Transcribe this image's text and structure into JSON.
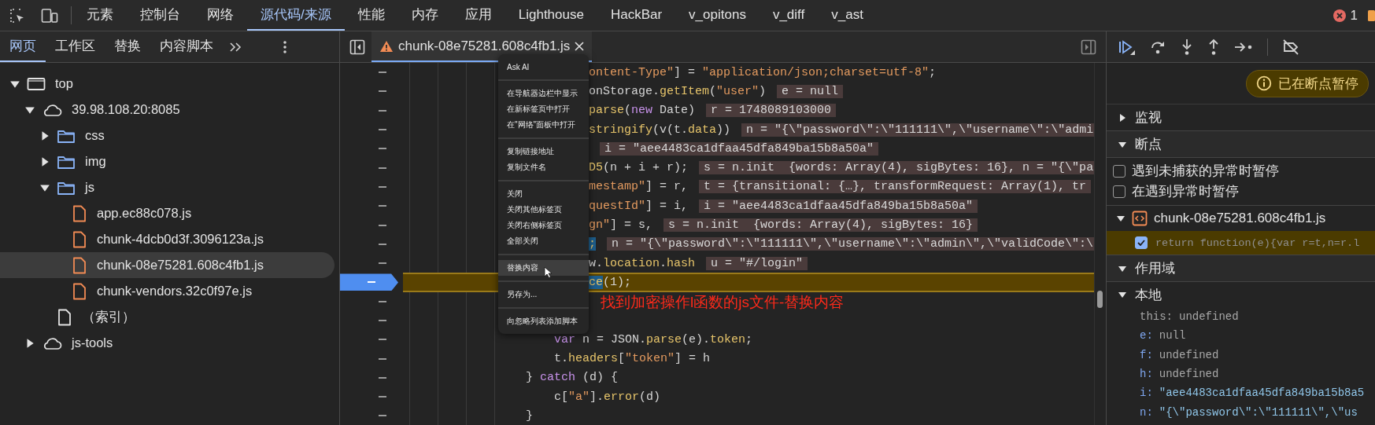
{
  "toolbar": {
    "tabs": [
      {
        "label": "元素",
        "selected": false
      },
      {
        "label": "控制台",
        "selected": false
      },
      {
        "label": "网络",
        "selected": false
      },
      {
        "label": "源代码/来源",
        "selected": true
      },
      {
        "label": "性能",
        "selected": false
      },
      {
        "label": "内存",
        "selected": false
      },
      {
        "label": "应用",
        "selected": false
      },
      {
        "label": "Lighthouse",
        "selected": false
      },
      {
        "label": "HackBar",
        "selected": false
      },
      {
        "label": "v_opitons",
        "selected": false
      },
      {
        "label": "v_diff",
        "selected": false
      },
      {
        "label": "v_ast",
        "selected": false
      }
    ],
    "error_count": "1"
  },
  "navigator": {
    "tabs": [
      {
        "label": "网页",
        "selected": true
      },
      {
        "label": "工作区",
        "selected": false
      },
      {
        "label": "替换",
        "selected": false
      },
      {
        "label": "内容脚本",
        "selected": false
      }
    ],
    "tree": [
      {
        "label": "top",
        "kind": "frame",
        "expanded": true,
        "selected": false,
        "children": [
          {
            "label": "39.98.108.20:8085",
            "kind": "domain",
            "expanded": true,
            "selected": false,
            "children": [
              {
                "label": "css",
                "kind": "folder",
                "expanded": false,
                "selected": false
              },
              {
                "label": "img",
                "kind": "folder",
                "expanded": false,
                "selected": false
              },
              {
                "label": "js",
                "kind": "folder",
                "expanded": true,
                "selected": false,
                "children": [
                  {
                    "label": "app.ec88c078.js",
                    "kind": "script",
                    "selected": false
                  },
                  {
                    "label": "chunk-4dcb0d3f.3096123a.js",
                    "kind": "script",
                    "selected": false
                  },
                  {
                    "label": "chunk-08e75281.608c4fb1.js",
                    "kind": "script",
                    "selected": true
                  },
                  {
                    "label": "chunk-vendors.32c0f97e.js",
                    "kind": "script",
                    "selected": false
                  }
                ]
              },
              {
                "label": "（索引）",
                "kind": "document",
                "selected": false
              }
            ]
          },
          {
            "label": "js-tools",
            "kind": "domain",
            "expanded": false,
            "selected": false
          }
        ]
      }
    ]
  },
  "editor": {
    "tab": {
      "title": "chunk-08e75281.608c4fb1.js",
      "warning": true
    },
    "lines": [
      {
        "kind": "clipped",
        "paused": false,
        "tokens": [
          {
            "kind": "string",
            "text": "ontent-Type\""
          },
          {
            "kind": "plain",
            "text": "] = "
          },
          {
            "kind": "string",
            "text": "\"application/json;charset=utf-8\""
          },
          {
            "kind": "plain",
            "text": ";"
          }
        ]
      },
      {
        "kind": "clipped",
        "paused": false,
        "tokens": [
          {
            "kind": "plain",
            "text": "onStorage."
          },
          {
            "kind": "function",
            "text": "getItem"
          },
          {
            "kind": "plain",
            "text": "("
          },
          {
            "kind": "string",
            "text": "\"user\""
          },
          {
            "kind": "plain",
            "text": ")"
          }
        ],
        "value": "e = null"
      },
      {
        "kind": "clipped",
        "paused": false,
        "tokens": [
          {
            "kind": "function",
            "text": "parse"
          },
          {
            "kind": "plain",
            "text": "("
          },
          {
            "kind": "keyword",
            "text": "new"
          },
          {
            "kind": "plain",
            "text": " Date)"
          }
        ],
        "value": "r = 1748089103000"
      },
      {
        "kind": "clipped",
        "paused": false,
        "tokens": [
          {
            "kind": "function",
            "text": "stringify"
          },
          {
            "kind": "plain",
            "text": "(v(t."
          },
          {
            "kind": "function",
            "text": "data"
          },
          {
            "kind": "plain",
            "text": "))"
          }
        ],
        "value": "n = \"{\\\"password\\\":\\\"111111\\\",\\\"username\\\":\\\"admi"
      },
      {
        "kind": "clipped",
        "paused": false,
        "value": "i = \"aee4483ca1dfaa45dfa849ba15b8a50a\""
      },
      {
        "kind": "clipped",
        "paused": false,
        "tokens": [
          {
            "kind": "function",
            "text": "D5"
          },
          {
            "kind": "plain",
            "text": "(n + i + r);"
          }
        ],
        "value": "s = n.init  {words: Array(4), sigBytes: 16}, n = \"{\\\"pa"
      },
      {
        "kind": "clipped",
        "paused": false,
        "tokens": [
          {
            "kind": "string",
            "text": "mestamp\""
          },
          {
            "kind": "plain",
            "text": "] = r,"
          }
        ],
        "value": "t = {transitional: {…}, transformRequest: Array(1), tr"
      },
      {
        "kind": "clipped",
        "paused": false,
        "tokens": [
          {
            "kind": "string",
            "text": "questId\""
          },
          {
            "kind": "plain",
            "text": "] = i,"
          }
        ],
        "value": "i = \"aee4483ca1dfaa45dfa849ba15b8a50a\""
      },
      {
        "kind": "clipped",
        "paused": false,
        "tokens": [
          {
            "kind": "string",
            "text": "gn\""
          },
          {
            "kind": "plain",
            "text": "] = s,"
          }
        ],
        "value": "s = n.init  {words: Array(4), sigBytes: 16}"
      },
      {
        "kind": "clipped",
        "paused": false,
        "tokens": [
          {
            "kind": "selection",
            "text": ";"
          }
        ],
        "value": "n = \"{\\\"password\\\":\\\"111111\\\",\\\"username\\\":\\\"admin\\\",\\\"validCode\\\":\\"
      },
      {
        "kind": "clipped",
        "paused": false,
        "tokens": [
          {
            "kind": "plain",
            "text": "w."
          },
          {
            "kind": "function",
            "text": "location"
          },
          {
            "kind": "plain",
            "text": "."
          },
          {
            "kind": "function",
            "text": "hash"
          }
        ],
        "value": "u = \"#/login\""
      },
      {
        "kind": "clipped",
        "paused": true,
        "tokens": [
          {
            "kind": "selection",
            "text": "ce"
          },
          {
            "kind": "plain",
            "text": "(1);"
          }
        ]
      },
      {
        "kind": "blank",
        "paused": false
      },
      {
        "kind": "blank",
        "paused": false
      },
      {
        "kind": "block",
        "paused": false,
        "tokens": [
          {
            "kind": "keyword",
            "text": "var"
          },
          {
            "kind": "plain",
            "text": " n = JSON."
          },
          {
            "kind": "function",
            "text": "parse"
          },
          {
            "kind": "plain",
            "text": "(e)."
          },
          {
            "kind": "function",
            "text": "token"
          },
          {
            "kind": "plain",
            "text": ";"
          }
        ]
      },
      {
        "kind": "block",
        "paused": false,
        "tokens": [
          {
            "kind": "plain",
            "text": "t."
          },
          {
            "kind": "function",
            "text": "headers"
          },
          {
            "kind": "plain",
            "text": "["
          },
          {
            "kind": "string",
            "text": "\"token\""
          },
          {
            "kind": "plain",
            "text": "] = h"
          }
        ]
      },
      {
        "kind": "brace",
        "paused": false,
        "tokens": [
          {
            "kind": "plain",
            "text": "} "
          },
          {
            "kind": "keyword",
            "text": "catch"
          },
          {
            "kind": "plain",
            "text": " (d) {"
          }
        ]
      },
      {
        "kind": "block",
        "paused": false,
        "tokens": [
          {
            "kind": "plain",
            "text": "c["
          },
          {
            "kind": "string",
            "text": "\"a\""
          },
          {
            "kind": "plain",
            "text": "]."
          },
          {
            "kind": "function",
            "text": "error"
          },
          {
            "kind": "plain",
            "text": "(d)"
          }
        ]
      },
      {
        "kind": "brace",
        "paused": false,
        "tokens": [
          {
            "kind": "plain",
            "text": "}"
          }
        ]
      }
    ],
    "note": "找到加密操作l函数的js文件-替换内容"
  },
  "context_menu": {
    "groups": [
      [
        {
          "label": "Ask AI",
          "selected": false
        }
      ],
      [
        {
          "label": "在导航器边栏中显示",
          "selected": false
        },
        {
          "label": "在新标签页中打开",
          "selected": false
        },
        {
          "label": "在\"网络\"面板中打开",
          "selected": false
        }
      ],
      [
        {
          "label": "复制链接地址",
          "selected": false
        },
        {
          "label": "复制文件名",
          "selected": false
        }
      ],
      [
        {
          "label": "关闭",
          "selected": false
        },
        {
          "label": "关闭其他标签页",
          "selected": false
        },
        {
          "label": "关闭右侧标签页",
          "selected": false
        },
        {
          "label": "全部关闭",
          "selected": false
        }
      ],
      [
        {
          "label": "替换内容",
          "selected": true
        }
      ],
      [
        {
          "label": "另存为...",
          "selected": false
        }
      ],
      [
        {
          "label": "向忽略列表添加脚本",
          "selected": false
        }
      ]
    ]
  },
  "debugger": {
    "status": "已在断点暂停",
    "watch": {
      "label": "监视",
      "expanded": false
    },
    "breakpoints": {
      "label": "断点",
      "expanded": true,
      "options": [
        {
          "label": "遇到未捕获的异常时暂停",
          "checked": false
        },
        {
          "label": "在遇到异常时暂停",
          "checked": false
        }
      ],
      "files": [
        {
          "name": "chunk-08e75281.608c4fb1.js",
          "expanded": true,
          "breakpoints": [
            {
              "code": "return function(e){var r=t,n=r.l",
              "checked": true,
              "active": true
            }
          ]
        }
      ]
    },
    "scope": {
      "label": "作用域",
      "expanded": true,
      "groups": [
        {
          "label": "本地",
          "expanded": true,
          "variables": [
            {
              "name": "this:",
              "kind": "this",
              "value": "undefined"
            },
            {
              "name": "e:",
              "kind": "primitive",
              "value": "null"
            },
            {
              "name": "f:",
              "kind": "primitive",
              "value": "undefined"
            },
            {
              "name": "h:",
              "kind": "primitive",
              "value": "undefined"
            },
            {
              "name": "i:",
              "kind": "string",
              "value": "\"aee4483ca1dfaa45dfa849ba15b8a5"
            },
            {
              "name": "n:",
              "kind": "string",
              "value": "\"{\\\"password\\\":\\\"111111\\\",\\\"us"
            }
          ]
        }
      ]
    }
  }
}
